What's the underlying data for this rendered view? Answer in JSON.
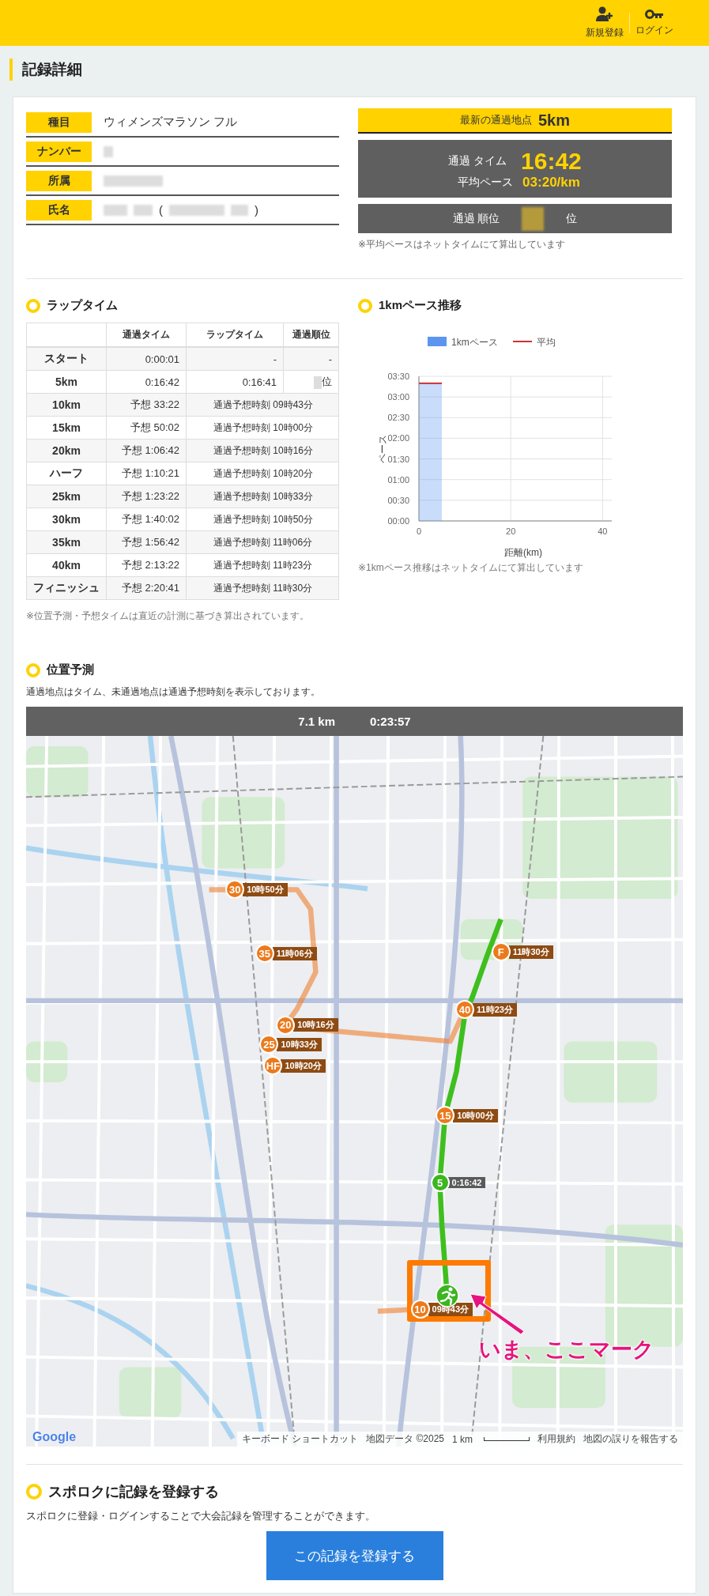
{
  "header": {
    "actions": [
      {
        "kind": "user_plus",
        "label": "新規登録"
      },
      {
        "kind": "key",
        "label": "ログイン"
      }
    ]
  },
  "page_title": "記録詳細",
  "record": {
    "fields": [
      {
        "label": "種目",
        "kind": "text",
        "value": "ウィメンズマラソン フル"
      },
      {
        "label": "ナンバー",
        "kind": "redacted"
      },
      {
        "label": "所属",
        "kind": "redacted"
      },
      {
        "label": "氏名",
        "kind": "redacted_name",
        "open": "(",
        "close": ")"
      }
    ]
  },
  "latest": {
    "label": "最新の通過地点",
    "point": "5km",
    "time_label": "通過 タイム",
    "time": "16:42",
    "pace_label": "平均ペース",
    "pace": "03:20/km",
    "rank_label": "通過 順位",
    "rank_unit": "位",
    "note": "※平均ペースはネットタイムにて算出しています"
  },
  "lap_section": {
    "title": "ラップタイム",
    "columns": [
      "通過タイム",
      "ラップタイム",
      "通過順位"
    ],
    "rows": [
      {
        "kind": "passed",
        "point": "スタート",
        "split": "0:00:01",
        "lap": "-",
        "rank": "-"
      },
      {
        "kind": "passed",
        "point": "5km",
        "split": "0:16:42",
        "lap": "0:16:41",
        "rank_unit": "位"
      },
      {
        "kind": "predicted",
        "point": "10km",
        "split": "予想 33:22",
        "eta": "通過予想時刻 09時43分"
      },
      {
        "kind": "predicted",
        "point": "15km",
        "split": "予想 50:02",
        "eta": "通過予想時刻 10時00分"
      },
      {
        "kind": "predicted",
        "point": "20km",
        "split": "予想 1:06:42",
        "eta": "通過予想時刻 10時16分"
      },
      {
        "kind": "predicted",
        "point": "ハーフ",
        "split": "予想 1:10:21",
        "eta": "通過予想時刻 10時20分"
      },
      {
        "kind": "predicted",
        "point": "25km",
        "split": "予想 1:23:22",
        "eta": "通過予想時刻 10時33分"
      },
      {
        "kind": "predicted",
        "point": "30km",
        "split": "予想 1:40:02",
        "eta": "通過予想時刻 10時50分"
      },
      {
        "kind": "predicted",
        "point": "35km",
        "split": "予想 1:56:42",
        "eta": "通過予想時刻 11時06分"
      },
      {
        "kind": "predicted",
        "point": "40km",
        "split": "予想 2:13:22",
        "eta": "通過予想時刻 11時23分"
      },
      {
        "kind": "predicted",
        "point": "フィニッシュ",
        "split": "予想 2:20:41",
        "eta": "通過予想時刻 11時30分"
      }
    ],
    "note": "※位置予測・予想タイムは直近の計測に基づき算出されています。"
  },
  "pace_section": {
    "title": "1kmペース推移",
    "chart_data": {
      "type": "bar",
      "xlabel": "距離(km)",
      "ylabel": "ペース",
      "x": [
        2.5
      ],
      "grid": true,
      "legend": "top",
      "series": [
        {
          "name": "1kmペース",
          "color": "#5b95f0",
          "values": [
            3.33
          ]
        }
      ],
      "ref_lines": [
        {
          "axis": "y",
          "label": "平均",
          "color": "#cc3333",
          "value": 3.33
        }
      ],
      "xlim": [
        0,
        42
      ],
      "ylim": [
        0,
        3.5
      ],
      "xticks": [
        0,
        20,
        40
      ],
      "yticks": [
        {
          "value": 0,
          "label": "00:00"
        },
        {
          "value": 0.5,
          "label": "00:30"
        },
        {
          "value": 1,
          "label": "01:00"
        },
        {
          "value": 1.5,
          "label": "01:30"
        },
        {
          "value": 2,
          "label": "02:00"
        },
        {
          "value": 2.5,
          "label": "02:30"
        },
        {
          "value": 3,
          "label": "03:00"
        },
        {
          "value": 3.5,
          "label": "03:30"
        }
      ]
    },
    "note": "※1kmペース推移はネットタイムにて算出しています"
  },
  "location": {
    "title": "位置予測",
    "description": "通過地点はタイム、未通過地点は通過予想時刻を表示しております。",
    "distance": "7.1 km",
    "elapsed": "0:23:57",
    "markers": [
      {
        "kind": "predicted",
        "number": "30",
        "label": "10時50分"
      },
      {
        "kind": "predicted",
        "number": "35",
        "label": "11時06分"
      },
      {
        "kind": "predicted",
        "number": "F",
        "label": "11時30分"
      },
      {
        "kind": "predicted",
        "number": "40",
        "label": "11時23分"
      },
      {
        "kind": "predicted",
        "number": "20",
        "label": "10時16分"
      },
      {
        "kind": "predicted",
        "number": "25",
        "label": "10時33分"
      },
      {
        "kind": "predicted",
        "number": "HF",
        "label": "10時20分"
      },
      {
        "kind": "predicted",
        "number": "15",
        "label": "10時00分"
      },
      {
        "kind": "passed",
        "number": "5",
        "label": "0:16:42"
      },
      {
        "kind": "predicted",
        "number": "10",
        "label": "09時43分"
      }
    ],
    "annotation": "いま、ここマーク",
    "google_logo": "Google",
    "attribution": [
      "キーボード ショートカット",
      "地図データ ©2025",
      "1 km",
      "利用規約",
      "地図の誤りを報告する"
    ]
  },
  "register": {
    "title": "スポロクに記録を登録する",
    "description": "スポロクに登録・ログインすることで大会記録を管理することができます。",
    "button": "この記録を登録する"
  }
}
